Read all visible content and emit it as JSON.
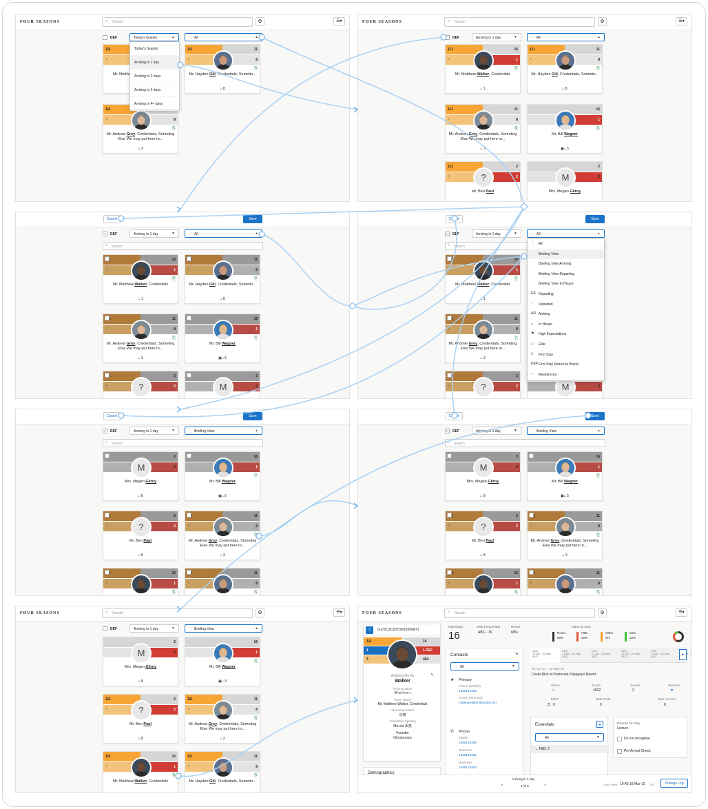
{
  "app": {
    "logo": "FOUR SEASONS",
    "search_placeholder": "Search",
    "gear": "⚙",
    "menu": "☰▾"
  },
  "edit": {
    "cancel": "Cancel",
    "save": "Save"
  },
  "filters": {
    "def": "DEF",
    "search_placeholder": "Search",
    "todays_guests": "Today's Guests",
    "arriving_1": "Arriving in 1 day",
    "all": "All",
    "briefing_view": "Briefing View"
  },
  "arrival_options": [
    "Today's Guests",
    "Arriving in 1 day",
    "Arriving in 2 days",
    "Arriving in 3 days",
    "Arriving in 4+ days"
  ],
  "view_options": [
    {
      "icon": "⋮",
      "label": "All"
    },
    {
      "icon": "",
      "label": "Briefing View"
    },
    {
      "icon": "",
      "label": "Briefing View Arriving"
    },
    {
      "icon": "",
      "label": "Briefing View Departing"
    },
    {
      "icon": "",
      "label": "Briefing View In House"
    },
    {
      "icon": "DE",
      "label": "Departing"
    },
    {
      "icon": "◌",
      "label": "Departed"
    },
    {
      "icon": "AR",
      "label": "Arriving"
    },
    {
      "icon": "⌂",
      "label": "In House"
    },
    {
      "icon": "⚑",
      "label": "High Expectations"
    },
    {
      "icon": "▭",
      "label": "Elite"
    },
    {
      "icon": "1",
      "label": "First Stay"
    },
    {
      "icon": "FSR",
      "label": "First Stay Return to Brand"
    },
    {
      "icon": "♀",
      "label": "Residences"
    }
  ],
  "guests": {
    "walker": {
      "pre": "Mr. Matthew ",
      "sur": "Walker",
      "post": ", Credentials",
      "l1": "111",
      "r1": "16",
      "r2": "1",
      "room": "1",
      "room2": "8"
    },
    "gill": {
      "pre": "Mr. Hayden ",
      "sur": "Gill",
      "post": ", Credentials, Sometin...",
      "l1": "111",
      "r1": "11",
      "r2": "8",
      "room": "8"
    },
    "grey": {
      "pre": "Mr. Andrew ",
      "sur": "Grey",
      "post": ", Credentials, Someting Else We may put here to...",
      "l1": "111",
      "r1": "11",
      "r2": "8",
      "room": "3",
      "room2": "2"
    },
    "wagner": {
      "pre": "Mr. Bill ",
      "sur": "Wagner",
      "post": "",
      "r1": "16",
      "r2": "1",
      "room": "5",
      "room2": "3"
    },
    "paul": {
      "pre": "Mr. Ben ",
      "sur": "Paul",
      "post": "",
      "l1": "111",
      "r1": "2",
      "r2": "2",
      "letter": "?",
      "room": "8"
    },
    "gilroy": {
      "pre": "Mrs. Megan ",
      "sur": "Gilroy",
      "post": "",
      "r1": "2",
      "r2": "2",
      "letter": "M",
      "room": "8"
    }
  },
  "matthew_short": {
    "pre": "Mr. Matthew ",
    "sur": "Walker",
    "post": ", Credentials"
  },
  "detail": {
    "code": "G172C3C2DC9610399A71",
    "bar1": {
      "l": "111",
      "r": "16"
    },
    "bar2": {
      "l": "1",
      "r": "1 DEF"
    },
    "bar3": {
      "l": "3",
      "r": "464"
    },
    "address_label": "Address Me As",
    "address": "Walker",
    "pron_label": "Pronunciation",
    "pron": "W-a-l-k-e-r",
    "given_label": "Given Name",
    "given": "Mr. Matthew Walker, Credentials",
    "alt_name_label": "Alternative Name",
    "alt_name": "马修",
    "alt_spell_label": "Alternative Spelling",
    "alt_spell": "Ma-xiu 沃克",
    "title1": "Founder",
    "title2": "Ghostronics",
    "demographics": "Demographics",
    "total_stays_label": "Total Stays",
    "total_stays": "16",
    "most_freq_label": "Most Frequented",
    "most_freq": "ABC - 15",
    "resort_label": "Resort",
    "resort": "68%",
    "value_label": "Value by Area",
    "values": [
      {
        "name": "Room",
        "pct": "58%",
        "color": "#333333"
      },
      {
        "name": "F&B",
        "pct": "30%",
        "color": "#e0573a"
      },
      {
        "name": "Other",
        "pct": "1%",
        "color": "#f0a030"
      },
      {
        "name": "Misc",
        "pct": "10%",
        "color": "#3cc03c"
      }
    ],
    "contacts_title": "Contacts",
    "contacts_filter": "All",
    "primary": "Primary",
    "phone_mobile_label": "Phone (Mobile)",
    "phone_mobile": "1555123480",
    "email_label": "Email (Personal)",
    "email": "mattewwalker@gmail.com",
    "phone_title": "Phone",
    "mobile_label": "Mobile",
    "mobile": "1555123480",
    "business_label": "Business",
    "business": "1555123481",
    "business2_label": "Business",
    "business2": "1555123482",
    "stay_tabs": [
      {
        "code": "CDS",
        "dates": "20 Apr - 25 May",
        "num": "4922"
      },
      {
        "code": "CDS",
        "dates": "21 Apr - 25 May",
        "num": "4922"
      },
      {
        "code": "CDS",
        "dates": "21 Apr - 25 May",
        "num": "4922"
      },
      {
        "code": "CDS",
        "dates": "21 Apr - 25 May",
        "num": "4922"
      },
      {
        "code": "CDS",
        "dates": "21 Apr - 25 May",
        "num": "4922"
      },
      {
        "code": "CDS",
        "dates": "21 Apr - 25 May",
        "num": ""
      }
    ],
    "stay_dates": "20-Apr-21 - 25-May-21",
    "stay_hotel": "Costa Rica at Peninsula Papagayo Resort",
    "status_label": "Status",
    "room_label": "Room",
    "room": "4922",
    "guests_label": "Guests",
    "guests_num": "2",
    "persona_label": "Persona",
    "elitch_label": "Elitch",
    "elitch": "0",
    "rate_code_label": "Rate Code",
    "rate_code": "0",
    "rate_amount_label": "Rate Amount",
    "rate_amount": "0",
    "essentials": "Essentials",
    "ess_filter": "All",
    "fb": "F&B: 2",
    "reason_label": "Reason for Stay",
    "reason": "Leisure",
    "dnr": "Do not recognise",
    "pac": "Pre Arrival Check",
    "footer_arriving": "Arriving in 1 day",
    "pager": "1 of 6",
    "last_edited_label": "Last Edited",
    "last_edited": "10:43 16-Mar-15",
    "by": "CBY",
    "change_log": "Change Log"
  }
}
